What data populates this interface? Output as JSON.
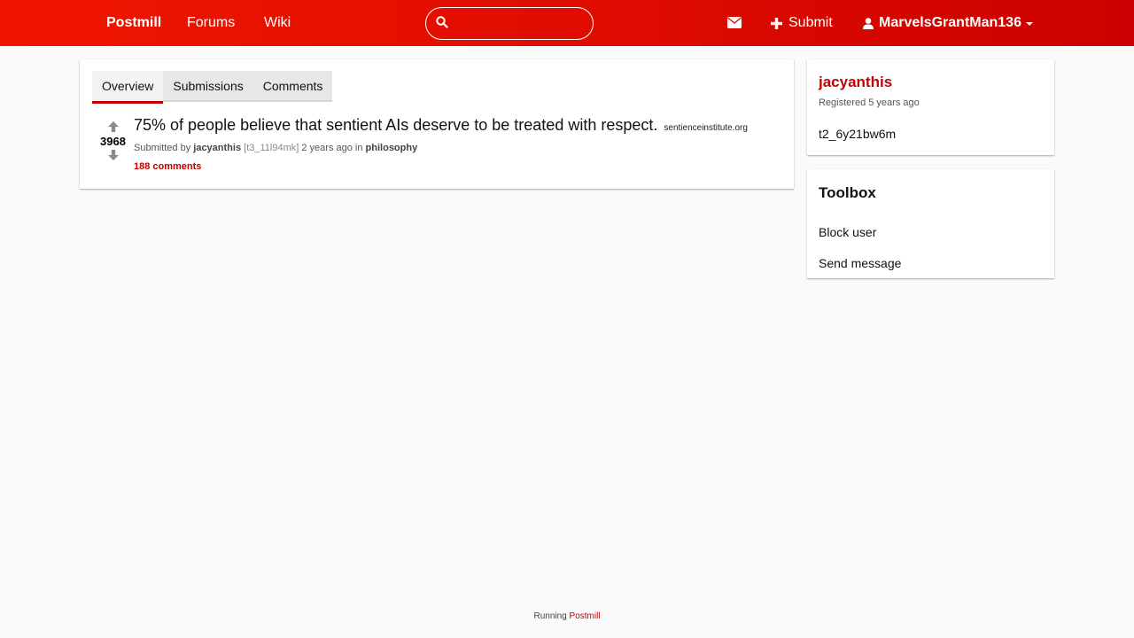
{
  "nav": {
    "brand": "Postmill",
    "forums": "Forums",
    "wiki": "Wiki",
    "search_placeholder": "",
    "submit": "Submit",
    "username": "MarvelsGrantMan136"
  },
  "tabs": [
    {
      "label": "Overview",
      "active": true
    },
    {
      "label": "Submissions",
      "active": false
    },
    {
      "label": "Comments",
      "active": false
    }
  ],
  "post": {
    "score": "3968",
    "title": "75% of people believe that sentient AIs deserve to be treated with respect.",
    "domain": "sentienceinstitute.org",
    "submitted_by_prefix": "Submitted by",
    "author": "jacyanthis",
    "post_id": "[t3_11l94mk]",
    "time": "2 years ago in",
    "forum": "philosophy",
    "comments": "188 comments"
  },
  "profile": {
    "name": "jacyanthis",
    "registered": "Registered 5 years ago",
    "user_id": "t2_6y21bw6m"
  },
  "toolbox": {
    "title": "Toolbox",
    "block_user": "Block user",
    "send_message": "Send message"
  },
  "footer": {
    "prefix": "Running",
    "link": "Postmill"
  },
  "colors": {
    "nav_gradient_start": "#f01500",
    "nav_gradient_end": "#cc0000",
    "accent": "#c40000",
    "background": "#fafafa"
  },
  "icons": [
    "search-icon",
    "mail-icon",
    "plus-icon",
    "user-icon",
    "chevron-down-icon",
    "upvote-icon",
    "downvote-icon"
  ]
}
